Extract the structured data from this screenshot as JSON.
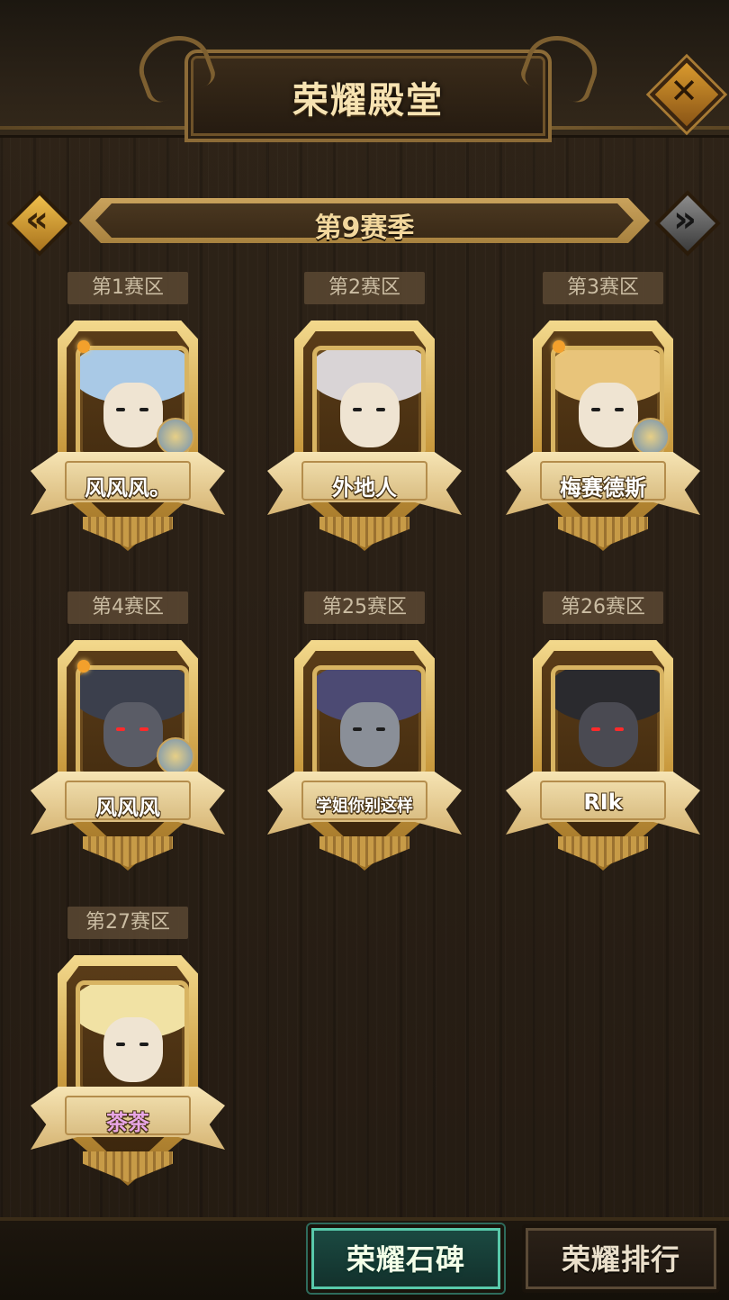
{
  "header": {
    "title": "荣耀殿堂",
    "close_glyph": "✕"
  },
  "season": {
    "label": "第9赛季",
    "prev_glyph": "«",
    "next_glyph": "»"
  },
  "zones": [
    {
      "zone": "第1赛区",
      "player": "风风风。",
      "hair_color": "#a9c9e6"
    },
    {
      "zone": "第2赛区",
      "player": "外地人",
      "hair_color": "#d9d4d6"
    },
    {
      "zone": "第3赛区",
      "player": "梅赛德斯",
      "hair_color": "#e8c47a"
    },
    {
      "zone": "第4赛区",
      "player": "风风风",
      "hair_color": "#3b3f4c"
    },
    {
      "zone": "第25赛区",
      "player": "学姐你别这样",
      "hair_color": "#4c4a73"
    },
    {
      "zone": "第26赛区",
      "player": "RIk",
      "hair_color": "#2a2a2e"
    },
    {
      "zone": "第27赛区",
      "player": "茶茶",
      "hair_color": "#f1e2a4"
    }
  ],
  "footer": {
    "stone_tab": "荣耀石碑",
    "rank_tab": "荣耀排行"
  },
  "colors": {
    "gold": "#d8b462",
    "accent_teal": "#58c9aa",
    "name_purple": "#e8a6e6"
  }
}
